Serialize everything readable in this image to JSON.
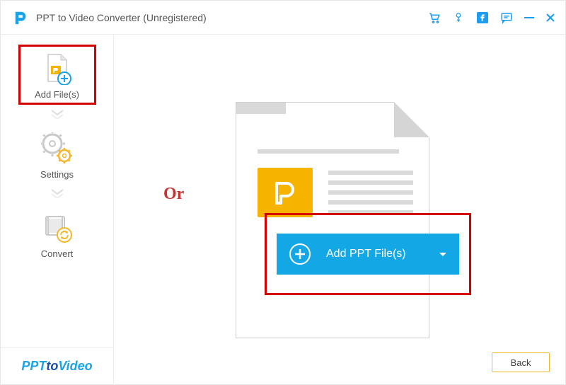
{
  "titlebar": {
    "title": "PPT to Video Converter (Unregistered)"
  },
  "sidebar": {
    "steps": [
      {
        "label": "Add File(s)"
      },
      {
        "label": "Settings"
      },
      {
        "label": "Convert"
      }
    ],
    "brand_part1": "PPT ",
    "brand_part2": "to",
    "brand_part3": " Video"
  },
  "content": {
    "or_label": "Or",
    "add_button_label": "Add PPT File(s)",
    "back_label": "Back"
  },
  "colors": {
    "accent": "#14a7e6",
    "warning_border": "#f3b72c",
    "highlight": "#d40000",
    "ppt_badge": "#f6b400"
  }
}
